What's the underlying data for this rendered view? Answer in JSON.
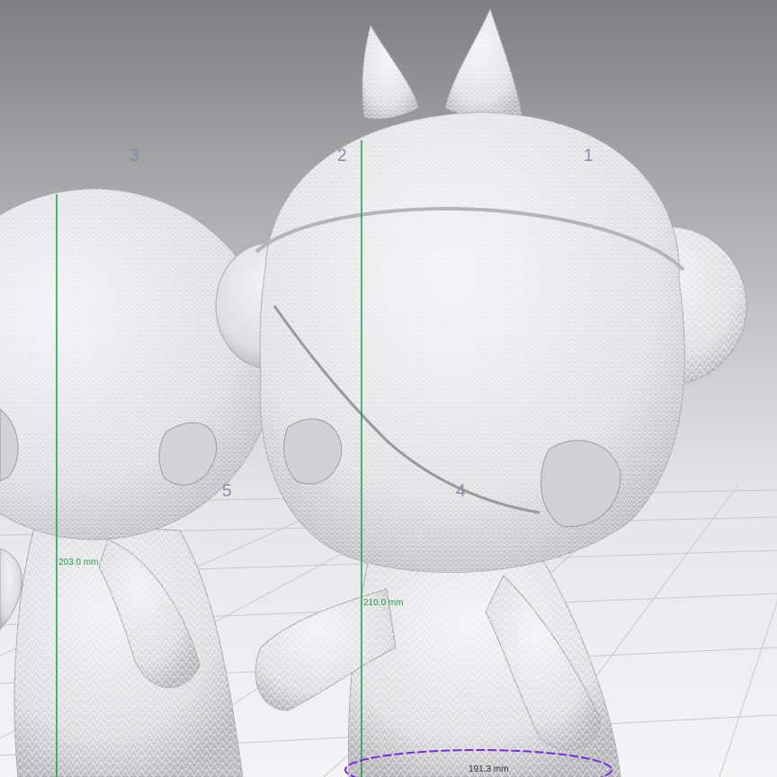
{
  "viewport": {
    "background_top": "#7f7f81",
    "background_bottom": "#f4f4f6",
    "grid_color": "#c9c9cd"
  },
  "object_labels": [
    "3",
    "2",
    "1",
    "5",
    "4"
  ],
  "measurements": {
    "height_left": "203.0 mm",
    "height_right": "210.0 mm",
    "diameter_base": "191.3 mm"
  },
  "colors": {
    "height_line": "#1f9a4a",
    "base_circle": "#7a2be0",
    "model_fill": "#e4e4e6",
    "mesh_line": "#ffffff"
  }
}
